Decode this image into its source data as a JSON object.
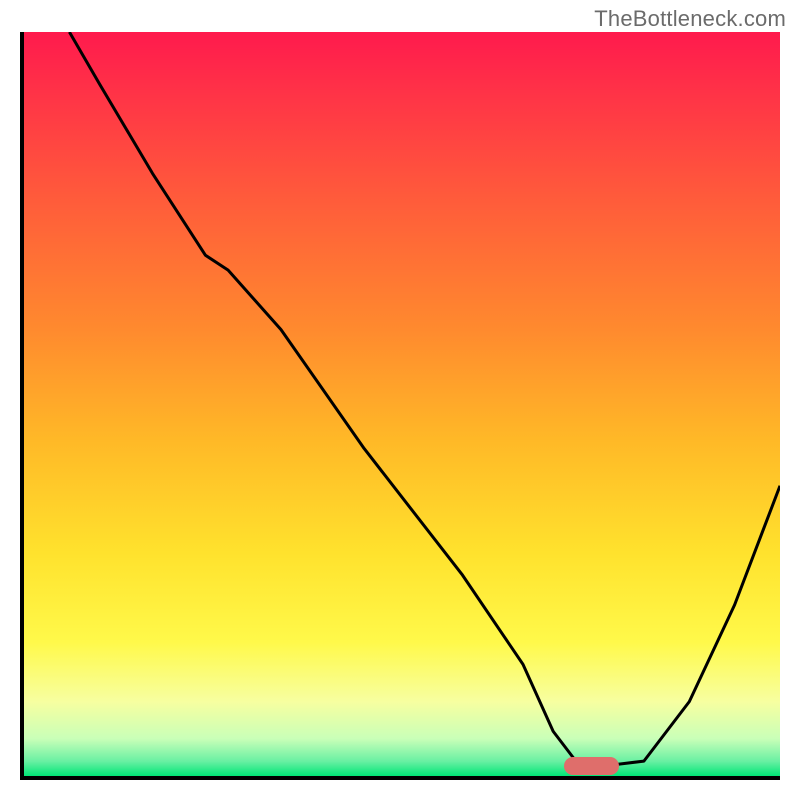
{
  "watermark": "TheBottleneck.com",
  "chart_data": {
    "type": "line",
    "title": "",
    "xlabel": "",
    "ylabel": "",
    "xlim": [
      0,
      100
    ],
    "ylim": [
      0,
      100
    ],
    "grid": false,
    "series": [
      {
        "name": "bottleneck-curve",
        "x": [
          6,
          10,
          17,
          24,
          27,
          34,
          45,
          58,
          66,
          70,
          73,
          75,
          78,
          82,
          88,
          94,
          100
        ],
        "values": [
          100,
          93,
          81,
          70,
          68,
          60,
          44,
          27,
          15,
          6,
          2,
          1.5,
          1.5,
          2,
          10,
          23,
          39
        ]
      }
    ],
    "marker": {
      "x": 75,
      "y": 1.3,
      "color": "#df6e6b"
    },
    "background_gradient_top": "#ff1a4d",
    "background_gradient_bottom": "#00e676"
  }
}
